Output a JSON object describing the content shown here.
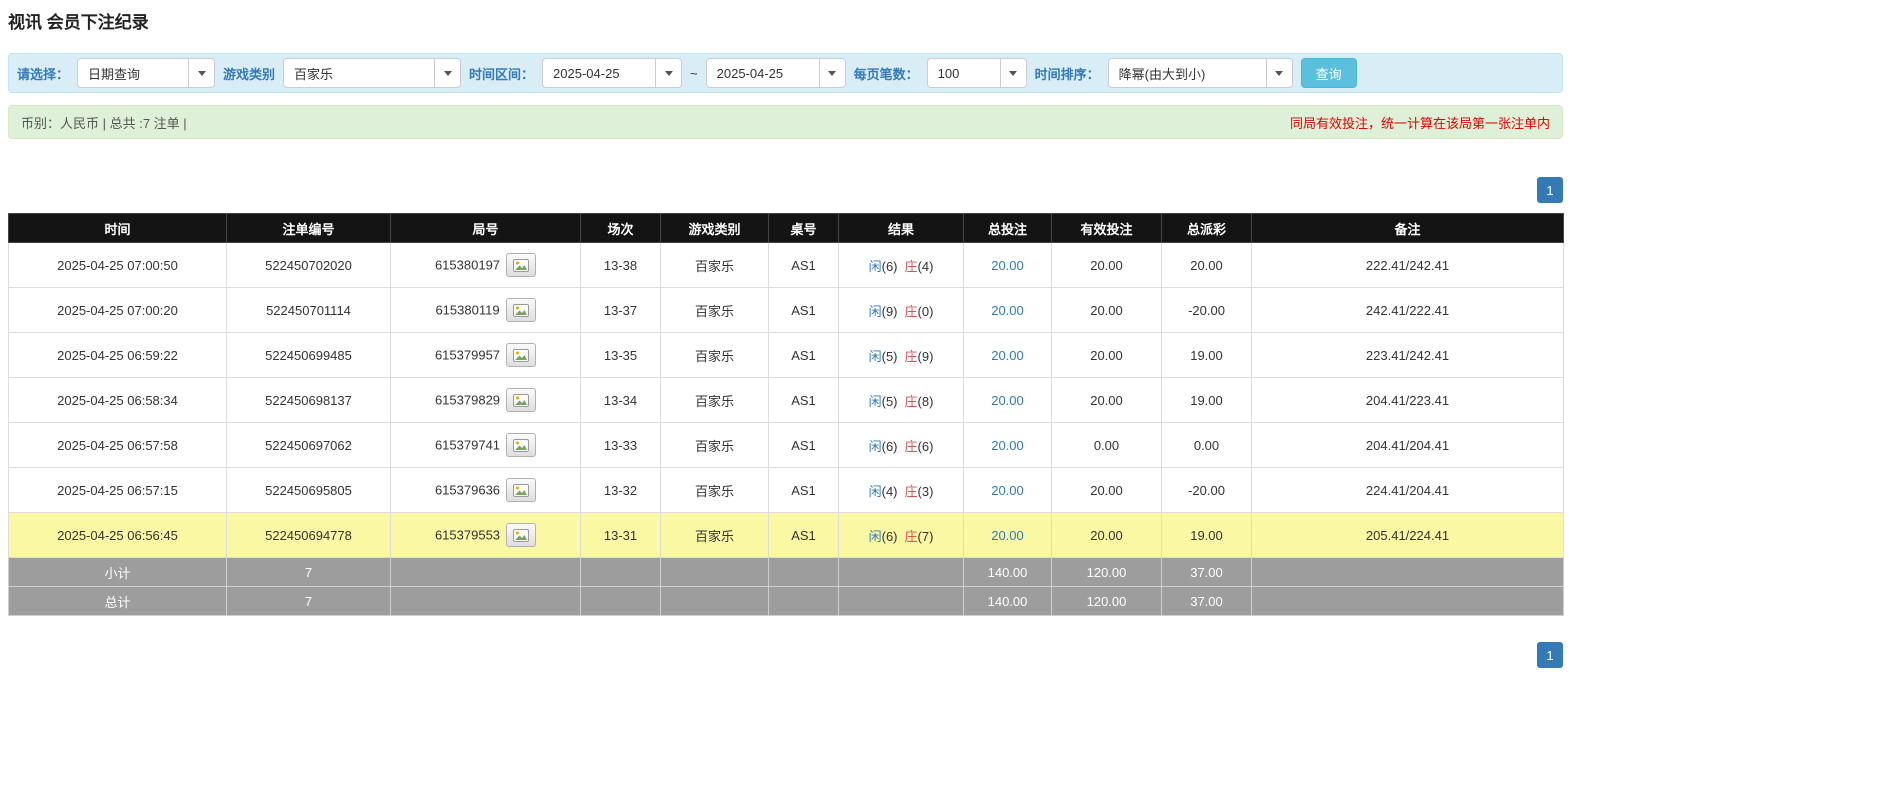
{
  "page": {
    "title": "视讯 会员下注纪录"
  },
  "filter_bar": {
    "query_type_label": "请选择：",
    "query_type_value": "日期查询",
    "game_category_label": "游戏类别",
    "game_category_value": "百家乐",
    "time_range_label": "时间区间：",
    "date_from": "2025-04-25",
    "range_separator": "~",
    "date_to": "2025-04-25",
    "page_size_label": "每页笔数：",
    "page_size_value": "100",
    "sort_label": "时间排序：",
    "sort_value": "降幂(由大到小)",
    "search_button_label": "查询"
  },
  "summary_bar": {
    "left_text": "币别：人民币 | 总共 :7 注单 |",
    "right_notice": "同局有效投注，统一计算在该局第一张注单内"
  },
  "pagination": {
    "current_page": "1"
  },
  "table": {
    "headers": [
      "时间",
      "注单编号",
      "局号",
      "场次",
      "游戏类别",
      "桌号",
      "结果",
      "总投注",
      "有效投注",
      "总派彩",
      "备注"
    ],
    "rows": [
      {
        "time": "2025-04-25 07:00:50",
        "bet_no": "522450702020",
        "round_no": "615380197",
        "session": "13-38",
        "game": "百家乐",
        "table_no": "AS1",
        "result": {
          "player": "闲",
          "player_score": "(6)",
          "banker": "庄",
          "banker_score": "(4)"
        },
        "total_bet": "20.00",
        "valid_bet": "20.00",
        "payout": "20.00",
        "note": "222.41/242.41",
        "highlighted": false
      },
      {
        "time": "2025-04-25 07:00:20",
        "bet_no": "522450701114",
        "round_no": "615380119",
        "session": "13-37",
        "game": "百家乐",
        "table_no": "AS1",
        "result": {
          "player": "闲",
          "player_score": "(9)",
          "banker": "庄",
          "banker_score": "(0)"
        },
        "total_bet": "20.00",
        "valid_bet": "20.00",
        "payout": "-20.00",
        "note": "242.41/222.41",
        "highlighted": false
      },
      {
        "time": "2025-04-25 06:59:22",
        "bet_no": "522450699485",
        "round_no": "615379957",
        "session": "13-35",
        "game": "百家乐",
        "table_no": "AS1",
        "result": {
          "player": "闲",
          "player_score": "(5)",
          "banker": "庄",
          "banker_score": "(9)"
        },
        "total_bet": "20.00",
        "valid_bet": "20.00",
        "payout": "19.00",
        "note": "223.41/242.41",
        "highlighted": false
      },
      {
        "time": "2025-04-25 06:58:34",
        "bet_no": "522450698137",
        "round_no": "615379829",
        "session": "13-34",
        "game": "百家乐",
        "table_no": "AS1",
        "result": {
          "player": "闲",
          "player_score": "(5)",
          "banker": "庄",
          "banker_score": "(8)"
        },
        "total_bet": "20.00",
        "valid_bet": "20.00",
        "payout": "19.00",
        "note": "204.41/223.41",
        "highlighted": false
      },
      {
        "time": "2025-04-25 06:57:58",
        "bet_no": "522450697062",
        "round_no": "615379741",
        "session": "13-33",
        "game": "百家乐",
        "table_no": "AS1",
        "result": {
          "player": "闲",
          "player_score": "(6)",
          "banker": "庄",
          "banker_score": "(6)"
        },
        "total_bet": "20.00",
        "valid_bet": "0.00",
        "payout": "0.00",
        "note": "204.41/204.41",
        "highlighted": false
      },
      {
        "time": "2025-04-25 06:57:15",
        "bet_no": "522450695805",
        "round_no": "615379636",
        "session": "13-32",
        "game": "百家乐",
        "table_no": "AS1",
        "result": {
          "player": "闲",
          "player_score": "(4)",
          "banker": "庄",
          "banker_score": "(3)"
        },
        "total_bet": "20.00",
        "valid_bet": "20.00",
        "payout": "-20.00",
        "note": "224.41/204.41",
        "highlighted": false
      },
      {
        "time": "2025-04-25 06:56:45",
        "bet_no": "522450694778",
        "round_no": "615379553",
        "session": "13-31",
        "game": "百家乐",
        "table_no": "AS1",
        "result": {
          "player": "闲",
          "player_score": "(6)",
          "banker": "庄",
          "banker_score": "(7)"
        },
        "total_bet": "20.00",
        "valid_bet": "20.00",
        "payout": "19.00",
        "note": "205.41/224.41",
        "highlighted": true
      }
    ],
    "footer": [
      {
        "label": "小计",
        "count": "7",
        "total_bet": "140.00",
        "valid_bet": "120.00",
        "payout": "37.00"
      },
      {
        "label": "总计",
        "count": "7",
        "total_bet": "140.00",
        "valid_bet": "120.00",
        "payout": "37.00"
      }
    ]
  },
  "colors": {
    "accent_blue": "#337ab7",
    "banker_red": "#d9534f",
    "negative_red": "#d9534f",
    "notice_red": "#e60000",
    "filter_bar_bg": "#d9edf7",
    "summary_bar_bg": "#dff0d8",
    "table_header_bg": "#141414",
    "highlight_yellow": "#fbf8a3",
    "footer_gray": "#9d9d9d",
    "search_button_bg": "#5bc0de"
  }
}
